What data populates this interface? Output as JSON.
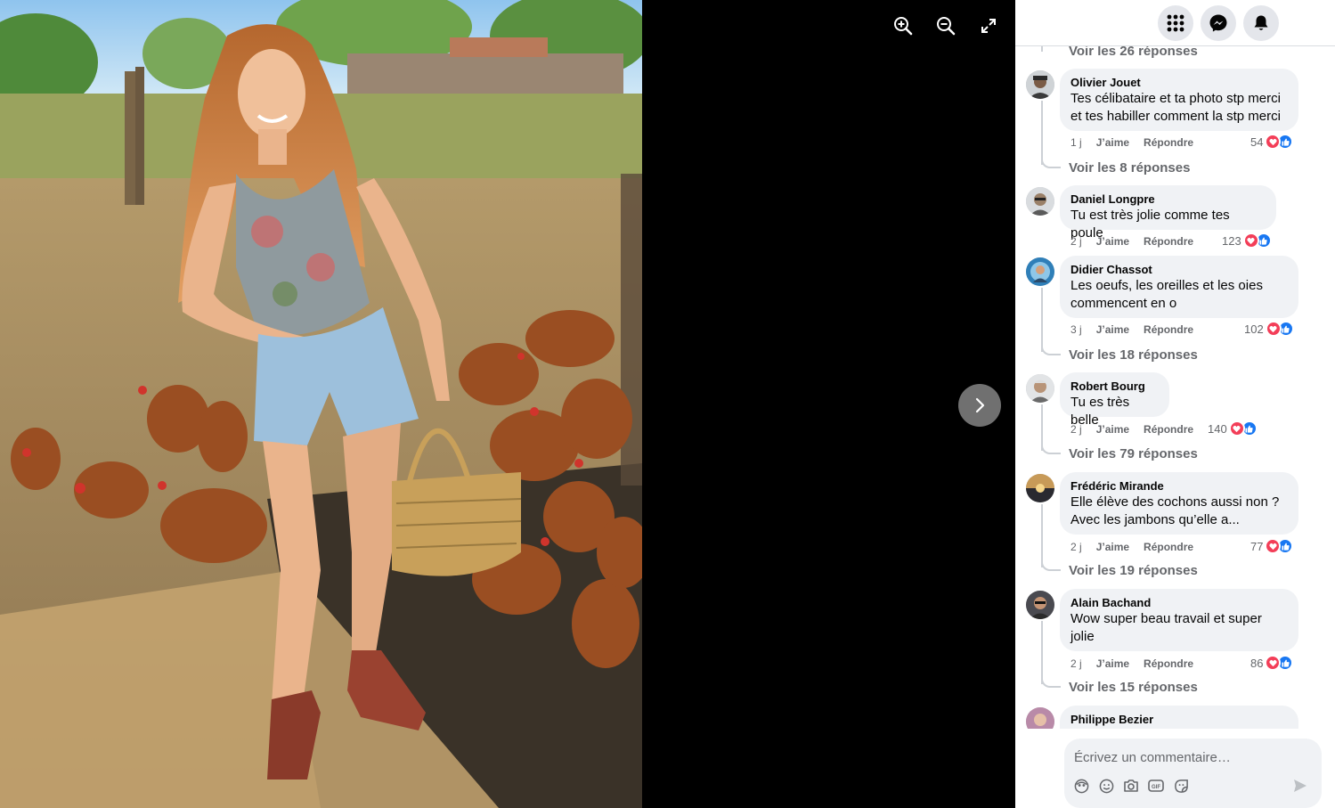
{
  "viewer": {
    "zoom_in_icon": "zoom-in-icon",
    "zoom_out_icon": "zoom-out-icon",
    "fullscreen_icon": "fullscreen-icon",
    "next_icon": "chevron-right-icon"
  },
  "header": {
    "menu_icon": "grid-menu-icon",
    "messenger_icon": "messenger-icon",
    "notifications_icon": "bell-icon"
  },
  "top_replies_link": "Voir les 26 réponses",
  "comments": [
    {
      "author": "Olivier Jouet",
      "lines": [
        "Tes célibataire et ta photo stp merci",
        "et tes habiller comment la stp merci"
      ],
      "time": "1 j",
      "like": "J’aime",
      "reply": "Répondre",
      "reactions": "54",
      "replies_link": "Voir les 8 réponses"
    },
    {
      "author": "Daniel Longpre",
      "lines": [
        "Tu est très jolie comme tes poule"
      ],
      "time": "2 j",
      "like": "J’aime",
      "reply": "Répondre",
      "reactions": "123",
      "replies_link": ""
    },
    {
      "author": "Didier Chassot",
      "lines": [
        "Les oeufs, les oreilles et les oies",
        "commencent en o"
      ],
      "time": "3 j",
      "like": "J’aime",
      "reply": "Répondre",
      "reactions": "102",
      "replies_link": "Voir les 18 réponses"
    },
    {
      "author": "Robert Bourg",
      "lines": [
        "Tu es très belle"
      ],
      "time": "2 j",
      "like": "J’aime",
      "reply": "Répondre",
      "reactions": "140",
      "replies_link": "Voir les 79 réponses"
    },
    {
      "author": "Frédéric Mirande",
      "lines": [
        "Elle élève des cochons aussi non ?",
        "Avec les jambons qu’elle a..."
      ],
      "time": "2 j",
      "like": "J’aime",
      "reply": "Répondre",
      "reactions": "77",
      "replies_link": "Voir les 19 réponses"
    },
    {
      "author": "Alain Bachand",
      "lines": [
        "Wow super beau travail et super",
        "jolie"
      ],
      "time": "2 j",
      "like": "J’aime",
      "reply": "Répondre",
      "reactions": "86",
      "replies_link": "Voir les 15 réponses"
    },
    {
      "author": "Philippe Bezier",
      "lines": [],
      "time": "",
      "like": "",
      "reply": "",
      "reactions": "",
      "replies_link": ""
    }
  ],
  "composer": {
    "placeholder": "Écrivez un commentaire…",
    "icons": [
      "avatar-sticker-icon",
      "emoji-icon",
      "camera-icon",
      "gif-icon",
      "sticker-icon"
    ],
    "send_icon": "send-icon"
  },
  "colors": {
    "reply_link": "#65676b",
    "bubble": "#f0f2f5",
    "heart": "#f33e58",
    "like": "#1877f2"
  }
}
